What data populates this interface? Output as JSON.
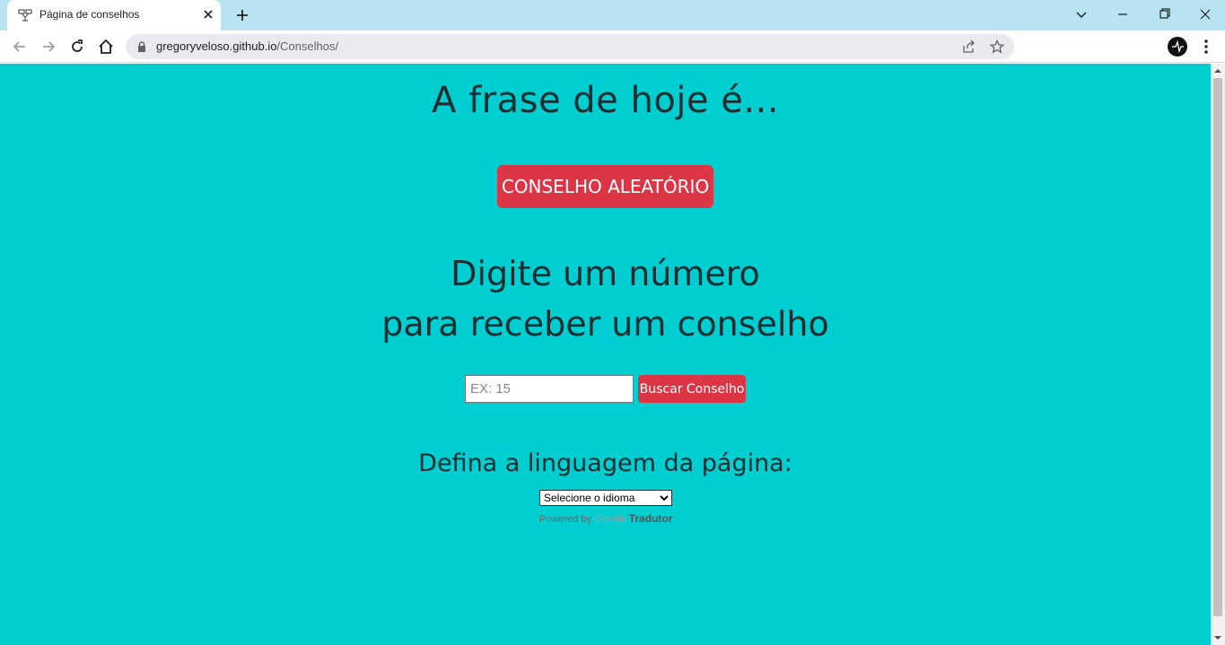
{
  "browser": {
    "tab_title": "Página de conselhos",
    "url_host": "gregoryveloso.github.io",
    "url_path": "/Conselhos/"
  },
  "page": {
    "heading_today": "A frase de hoje é...",
    "random_button": "CONSELHO ALEATÓRIO",
    "heading_digit_line1": "Digite um número",
    "heading_digit_line2": "para receber um conselho",
    "number_placeholder": "EX: 15",
    "search_button": "Buscar Conselho",
    "heading_language": "Defina a linguagem da página:",
    "language_select_value": "Selecione o idioma",
    "powered_by": "Powered by",
    "google": "Google",
    "translator": "Tradutor"
  },
  "colors": {
    "background": "#00ced1",
    "button": "#dc3545",
    "heading": "#1f2d30",
    "tabstrip": "#b8e4f2"
  }
}
